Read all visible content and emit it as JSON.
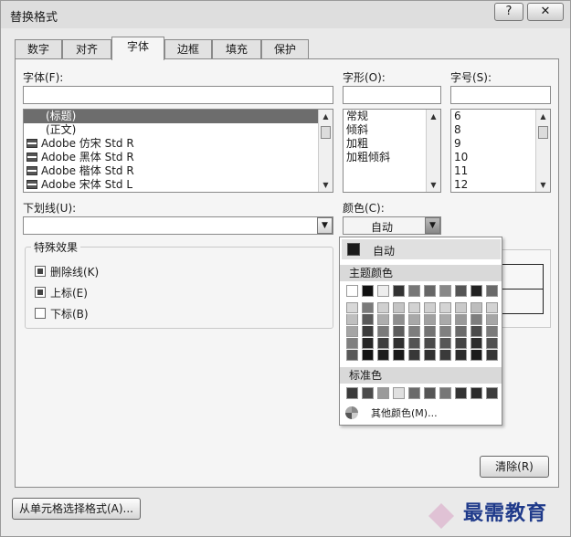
{
  "window": {
    "title": "替换格式",
    "help_label": "?",
    "close_label": "✕"
  },
  "tabs": [
    {
      "label": "数字"
    },
    {
      "label": "对齐"
    },
    {
      "label": "字体",
      "active": true
    },
    {
      "label": "边框"
    },
    {
      "label": "填充"
    },
    {
      "label": "保护"
    }
  ],
  "font": {
    "label": "字体(F):",
    "value": "",
    "items": [
      "(标题)",
      "(正文)",
      "Adobe 仿宋 Std R",
      "Adobe 黑体 Std R",
      "Adobe 楷体 Std R",
      "Adobe 宋体 Std L"
    ],
    "selected_index": 0
  },
  "style": {
    "label": "字形(O):",
    "value": "",
    "items": [
      "常规",
      "倾斜",
      "加粗",
      "加粗倾斜"
    ]
  },
  "size": {
    "label": "字号(S):",
    "value": "",
    "items": [
      "6",
      "8",
      "9",
      "10",
      "11",
      "12"
    ]
  },
  "underline": {
    "label": "下划线(U):",
    "value": ""
  },
  "color": {
    "label": "颜色(C):",
    "value": "自动"
  },
  "effects": {
    "legend": "特殊效果",
    "strikethrough": "删除线(K)",
    "superscript": "上标(E)",
    "subscript": "下标(B)"
  },
  "color_popup": {
    "auto_label": "自动",
    "theme_header": "主题颜色",
    "standard_header": "标准色",
    "more_label": "其他颜色(M)...",
    "theme_top": [
      "#ffffff",
      "#111111",
      "#eeeeee",
      "#333333",
      "#777777",
      "#666666",
      "#888888",
      "#555555",
      "#222222",
      "#6a6a6a"
    ],
    "theme_shades": [
      [
        "#d8d8d8",
        "#7a7a7a",
        "#d0d0d0",
        "#c4c4c4",
        "#d2d2d2",
        "#cfcfcf",
        "#d4d4d4",
        "#cacaca",
        "#bdbdbd",
        "#d3d3d3"
      ],
      [
        "#bfbfbf",
        "#5a5a5a",
        "#adadad",
        "#8e8e8e",
        "#a8a8a8",
        "#a0a0a0",
        "#aaaaaa",
        "#999999",
        "#7e7e7e",
        "#a6a6a6"
      ],
      [
        "#a5a5a5",
        "#3c3c3c",
        "#7a7a7a",
        "#5c5c5c",
        "#7d7d7d",
        "#737373",
        "#808080",
        "#6b6b6b",
        "#4c4c4c",
        "#7a7a7a"
      ],
      [
        "#7f7f7f",
        "#262626",
        "#3d3d3d",
        "#2f2f2f",
        "#535353",
        "#4a4a4a",
        "#565656",
        "#444444",
        "#2c2c2c",
        "#515151"
      ],
      [
        "#595959",
        "#141414",
        "#1d1d1d",
        "#1a1a1a",
        "#383838",
        "#313131",
        "#3a3a3a",
        "#2d2d2d",
        "#1a1a1a",
        "#363636"
      ]
    ],
    "standard": [
      "#3a3a3a",
      "#4a4a4a",
      "#9a9a9a",
      "#e0e0e0",
      "#6a6a6a",
      "#555555",
      "#777777",
      "#333333",
      "#2a2a2a",
      "#3c3c3c"
    ]
  },
  "buttons": {
    "clear": "清除(R)",
    "choose_from_cell": "从单元格选择格式(A)..."
  },
  "watermark": {
    "text": "最需教育"
  }
}
